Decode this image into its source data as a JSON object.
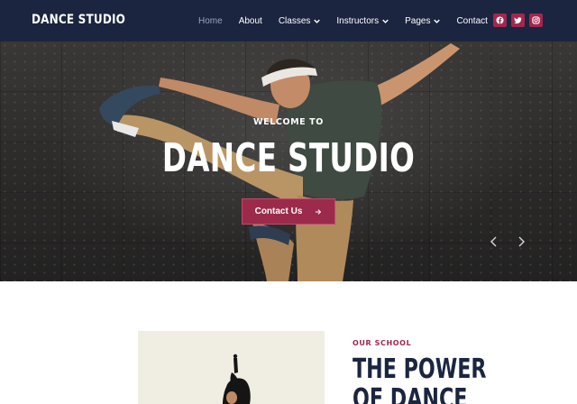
{
  "header": {
    "logo": "DANCE STUDIO",
    "nav": [
      {
        "label": "Home",
        "dropdown": false,
        "active": true
      },
      {
        "label": "About",
        "dropdown": false,
        "active": false
      },
      {
        "label": "Classes",
        "dropdown": true,
        "active": false
      },
      {
        "label": "Instructors",
        "dropdown": true,
        "active": false
      },
      {
        "label": "Pages",
        "dropdown": true,
        "active": false
      },
      {
        "label": "Contact",
        "dropdown": false,
        "active": false
      }
    ],
    "social": [
      {
        "icon": "facebook-icon"
      },
      {
        "icon": "twitter-icon"
      },
      {
        "icon": "instagram-icon"
      }
    ]
  },
  "hero": {
    "eyebrow": "WELCOME TO",
    "title": "DANCE STUDIO",
    "cta_label": "Contact Us",
    "cta_icon": "arrow-right-icon",
    "prev_icon": "chevron-left-icon",
    "next_icon": "chevron-right-icon"
  },
  "about": {
    "eyebrow": "OUR SCHOOL",
    "title_line1": "THE POWER",
    "title_line2": "OF DANCE"
  },
  "colors": {
    "navy": "#1b2540",
    "accent": "#a3264d",
    "cta": "#9b2a4b"
  }
}
